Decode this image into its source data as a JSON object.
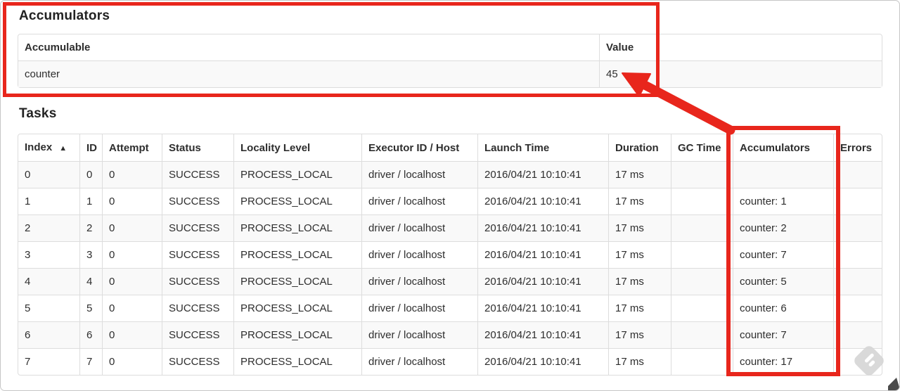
{
  "accumulators_section": {
    "title": "Accumulators",
    "table": {
      "headers": [
        "Accumulable",
        "Value"
      ],
      "rows": [
        [
          "counter",
          "45"
        ]
      ]
    }
  },
  "tasks_section": {
    "title": "Tasks",
    "table": {
      "headers": [
        "Index",
        "ID",
        "Attempt",
        "Status",
        "Locality Level",
        "Executor ID / Host",
        "Launch Time",
        "Duration",
        "GC Time",
        "Accumulators",
        "Errors"
      ],
      "sort_indicator": "▲",
      "rows": [
        [
          "0",
          "0",
          "0",
          "SUCCESS",
          "PROCESS_LOCAL",
          "driver / localhost",
          "2016/04/21 10:10:41",
          "17 ms",
          "",
          "",
          ""
        ],
        [
          "1",
          "1",
          "0",
          "SUCCESS",
          "PROCESS_LOCAL",
          "driver / localhost",
          "2016/04/21 10:10:41",
          "17 ms",
          "",
          "counter: 1",
          ""
        ],
        [
          "2",
          "2",
          "0",
          "SUCCESS",
          "PROCESS_LOCAL",
          "driver / localhost",
          "2016/04/21 10:10:41",
          "17 ms",
          "",
          "counter: 2",
          ""
        ],
        [
          "3",
          "3",
          "0",
          "SUCCESS",
          "PROCESS_LOCAL",
          "driver / localhost",
          "2016/04/21 10:10:41",
          "17 ms",
          "",
          "counter: 7",
          ""
        ],
        [
          "4",
          "4",
          "0",
          "SUCCESS",
          "PROCESS_LOCAL",
          "driver / localhost",
          "2016/04/21 10:10:41",
          "17 ms",
          "",
          "counter: 5",
          ""
        ],
        [
          "5",
          "5",
          "0",
          "SUCCESS",
          "PROCESS_LOCAL",
          "driver / localhost",
          "2016/04/21 10:10:41",
          "17 ms",
          "",
          "counter: 6",
          ""
        ],
        [
          "6",
          "6",
          "0",
          "SUCCESS",
          "PROCESS_LOCAL",
          "driver / localhost",
          "2016/04/21 10:10:41",
          "17 ms",
          "",
          "counter: 7",
          ""
        ],
        [
          "7",
          "7",
          "0",
          "SUCCESS",
          "PROCESS_LOCAL",
          "driver / localhost",
          "2016/04/21 10:10:41",
          "17 ms",
          "",
          "counter: 17",
          ""
        ]
      ]
    }
  },
  "annotations": {
    "color": "#e8261c"
  }
}
